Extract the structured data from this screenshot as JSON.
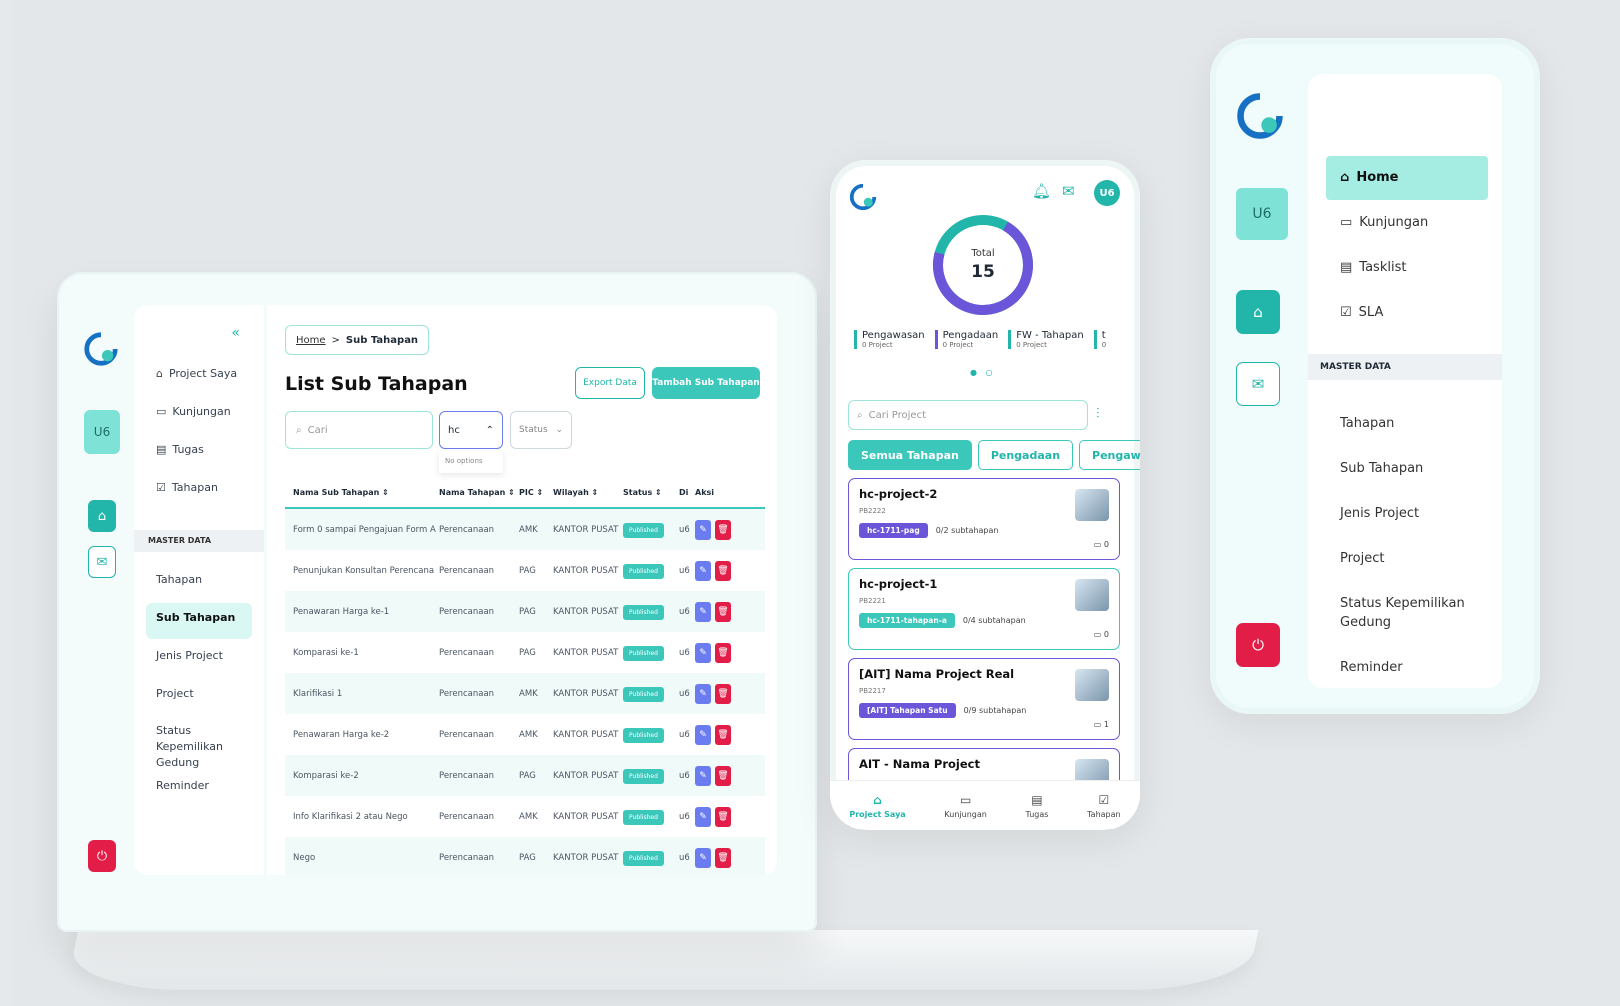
{
  "laptop": {
    "rail": {
      "avatar": "U6"
    },
    "sidebar": {
      "collapse_icon": "«",
      "items": [
        {
          "icon": "⌂",
          "label": "Project Saya"
        },
        {
          "icon": "▭",
          "label": "Kunjungan"
        },
        {
          "icon": "▤",
          "label": "Tugas"
        },
        {
          "icon": "☑",
          "label": "Tahapan"
        }
      ],
      "master_title": "MASTER DATA",
      "master_items": [
        "Tahapan",
        "Sub Tahapan",
        "Jenis Project",
        "Project",
        "Status Kepemilikan Gedung",
        "Reminder"
      ]
    },
    "breadcrumb": {
      "home": "Home",
      "sep": ">",
      "current": "Sub Tahapan"
    },
    "page_title": "List Sub Tahapan",
    "export_label": "Export Data",
    "add_label": "Tambah Sub Tahapan",
    "search_placeholder": "Cari",
    "filter_value": "hc",
    "filter_empty": "No options",
    "status_placeholder": "Status",
    "table": {
      "headers": [
        "Nama Sub Tahapan ⇕",
        "Nama Tahapan ⇕",
        "PIC ⇕",
        "Wilayah ⇕",
        "Status ⇕",
        "Di",
        "Aksi"
      ],
      "rows": [
        [
          "Form 0 sampai Pengajuan Form A",
          "Perencanaan",
          "AMK",
          "KANTOR PUSAT",
          "Published",
          "u6"
        ],
        [
          "Penunjukan Konsultan Perencana",
          "Perencanaan",
          "PAG",
          "KANTOR PUSAT",
          "Published",
          "u6"
        ],
        [
          "Penawaran Harga ke-1",
          "Perencanaan",
          "PAG",
          "KANTOR PUSAT",
          "Published",
          "u6"
        ],
        [
          "Komparasi ke-1",
          "Perencanaan",
          "PAG",
          "KANTOR PUSAT",
          "Published",
          "u6"
        ],
        [
          "Klarifikasi 1",
          "Perencanaan",
          "AMK",
          "KANTOR PUSAT",
          "Published",
          "u6"
        ],
        [
          "Penawaran Harga ke-2",
          "Perencanaan",
          "AMK",
          "KANTOR PUSAT",
          "Published",
          "u6"
        ],
        [
          "Komparasi ke-2",
          "Perencanaan",
          "PAG",
          "KANTOR PUSAT",
          "Published",
          "u6"
        ],
        [
          "Info Klarifikasi 2 atau Nego",
          "Perencanaan",
          "AMK",
          "KANTOR PUSAT",
          "Published",
          "u6"
        ],
        [
          "Nego",
          "Perencanaan",
          "PAG",
          "KANTOR PUSAT",
          "Published",
          "u6"
        ]
      ]
    }
  },
  "phone": {
    "avatar": "U6",
    "donut": {
      "label": "Total",
      "value": "15"
    },
    "stats": [
      {
        "label": "Pengawasan",
        "sub": "0 Project"
      },
      {
        "label": "Pengadaan",
        "sub": "0 Project"
      },
      {
        "label": "FW - Tahapan",
        "sub": "0 Project"
      },
      {
        "label": "t",
        "sub": "0"
      }
    ],
    "search_placeholder": "Cari Project",
    "chips": [
      "Semua Tahapan",
      "Pengadaan",
      "Pengaw"
    ],
    "cards": [
      {
        "title": "hc-project-2",
        "code": "PB2222",
        "tag": "hc-1711-pag",
        "progress": "0/2 subtahapan",
        "comments": "0"
      },
      {
        "title": "hc-project-1",
        "code": "PB2221",
        "tag": "hc-1711-tahapan-a",
        "progress": "0/4 subtahapan",
        "comments": "0"
      },
      {
        "title": "[AIT] Nama Project Real",
        "code": "PB2217",
        "tag": "[AIT] Tahapan Satu",
        "progress": "0/9 subtahapan",
        "comments": "1"
      },
      {
        "title": "AIT - Nama Project",
        "code": "",
        "tag": "",
        "progress": "",
        "comments": ""
      }
    ],
    "nav": [
      "Project Saya",
      "Kunjungan",
      "Tugas",
      "Tahapan"
    ]
  },
  "tablet": {
    "avatar": "U6",
    "menu": [
      {
        "icon": "⌂",
        "label": "Home"
      },
      {
        "icon": "▭",
        "label": "Kunjungan"
      },
      {
        "icon": "▤",
        "label": "Tasklist"
      },
      {
        "icon": "☑",
        "label": "SLA"
      }
    ],
    "master_title": "MASTER DATA",
    "master_items": [
      "Tahapan",
      "Sub Tahapan",
      "Jenis Project",
      "Project",
      "Status Kepemilikan Gedung",
      "Reminder"
    ]
  },
  "colors": {
    "teal": "#22b5a9",
    "purple": "#6b55d8",
    "red": "#e11d48"
  }
}
